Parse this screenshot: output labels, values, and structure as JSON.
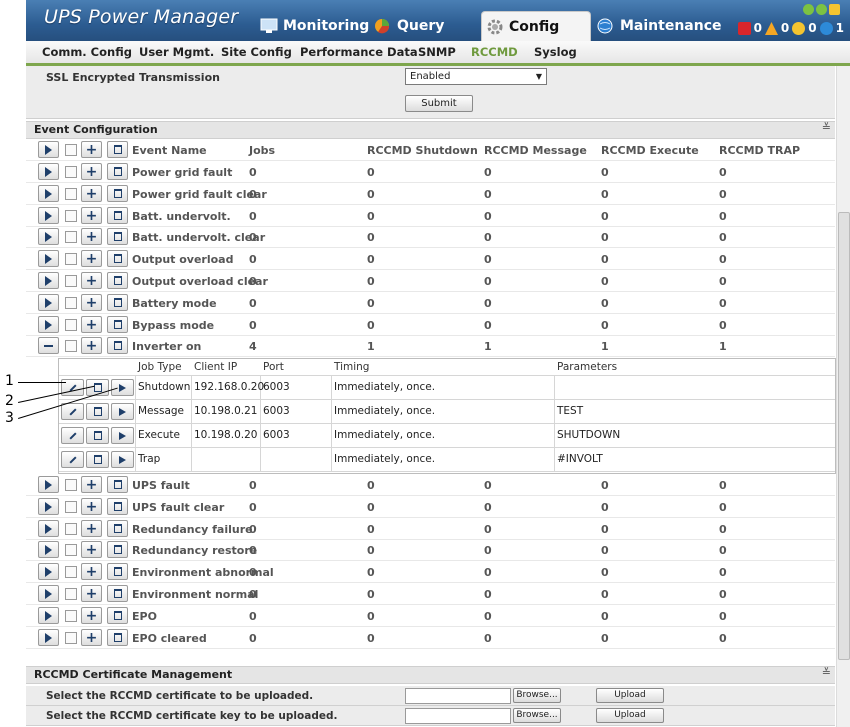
{
  "app": {
    "title": "UPS Power Manager"
  },
  "main_tabs": [
    {
      "label": "Monitoring",
      "icon": "monitor-icon"
    },
    {
      "label": "Query",
      "icon": "pie-chart-icon"
    },
    {
      "label": "Config",
      "icon": "gear-icon",
      "active": true
    },
    {
      "label": "Maintenance",
      "icon": "globe-icon"
    }
  ],
  "status": {
    "critical_count": "0",
    "warning_count": "0",
    "info_count": "0",
    "notice_count": "1"
  },
  "sub_tabs": [
    {
      "label": "Comm. Config"
    },
    {
      "label": "User Mgmt."
    },
    {
      "label": "Site Config"
    },
    {
      "label": "Performance Data"
    },
    {
      "label": "SNMP"
    },
    {
      "label": "RCCMD",
      "active": true
    },
    {
      "label": "Syslog"
    }
  ],
  "ssl": {
    "label": "SSL Encrypted Transmission",
    "value": "Enabled",
    "submit": "Submit"
  },
  "event_config": {
    "title": "Event Configuration",
    "columns": [
      "Event Name",
      "Jobs",
      "RCCMD Shutdown",
      "RCCMD Message",
      "RCCMD Execute",
      "RCCMD TRAP"
    ],
    "events_top": [
      {
        "name": "Power grid fault",
        "jobs": "0",
        "shutdown": "0",
        "message": "0",
        "execute": "0",
        "trap": "0"
      },
      {
        "name": "Power grid fault clear",
        "jobs": "0",
        "shutdown": "0",
        "message": "0",
        "execute": "0",
        "trap": "0"
      },
      {
        "name": "Batt. undervolt.",
        "jobs": "0",
        "shutdown": "0",
        "message": "0",
        "execute": "0",
        "trap": "0"
      },
      {
        "name": "Batt. undervolt. clear",
        "jobs": "0",
        "shutdown": "0",
        "message": "0",
        "execute": "0",
        "trap": "0"
      },
      {
        "name": "Output overload",
        "jobs": "0",
        "shutdown": "0",
        "message": "0",
        "execute": "0",
        "trap": "0"
      },
      {
        "name": "Output overload clear",
        "jobs": "0",
        "shutdown": "0",
        "message": "0",
        "execute": "0",
        "trap": "0"
      },
      {
        "name": "Battery mode",
        "jobs": "0",
        "shutdown": "0",
        "message": "0",
        "execute": "0",
        "trap": "0"
      },
      {
        "name": "Bypass mode",
        "jobs": "0",
        "shutdown": "0",
        "message": "0",
        "execute": "0",
        "trap": "0"
      },
      {
        "name": "Inverter on",
        "jobs": "4",
        "shutdown": "1",
        "message": "1",
        "execute": "1",
        "trap": "1"
      }
    ],
    "job_columns": [
      "Job Type",
      "Client IP",
      "Port",
      "Timing",
      "Parameters"
    ],
    "jobs": [
      {
        "type": "Shutdown",
        "ip": "192.168.0.20",
        "port": "6003",
        "timing": "Immediately, once.",
        "params": ""
      },
      {
        "type": "Message",
        "ip": "10.198.0.21",
        "port": "6003",
        "timing": "Immediately, once.",
        "params": "TEST"
      },
      {
        "type": "Execute",
        "ip": "10.198.0.20",
        "port": "6003",
        "timing": "Immediately, once.",
        "params": "SHUTDOWN"
      },
      {
        "type": "Trap",
        "ip": "",
        "port": "",
        "timing": "Immediately, once.",
        "params": "#INVOLT"
      }
    ],
    "events_bottom": [
      {
        "name": "UPS fault",
        "jobs": "0",
        "shutdown": "0",
        "message": "0",
        "execute": "0",
        "trap": "0"
      },
      {
        "name": "UPS fault clear",
        "jobs": "0",
        "shutdown": "0",
        "message": "0",
        "execute": "0",
        "trap": "0"
      },
      {
        "name": "Redundancy failure",
        "jobs": "0",
        "shutdown": "0",
        "message": "0",
        "execute": "0",
        "trap": "0"
      },
      {
        "name": "Redundancy restore",
        "jobs": "0",
        "shutdown": "0",
        "message": "0",
        "execute": "0",
        "trap": "0"
      },
      {
        "name": "Environment abnormal",
        "jobs": "0",
        "shutdown": "0",
        "message": "0",
        "execute": "0",
        "trap": "0"
      },
      {
        "name": "Environment normal",
        "jobs": "0",
        "shutdown": "0",
        "message": "0",
        "execute": "0",
        "trap": "0"
      },
      {
        "name": "EPO",
        "jobs": "0",
        "shutdown": "0",
        "message": "0",
        "execute": "0",
        "trap": "0"
      },
      {
        "name": "EPO cleared",
        "jobs": "0",
        "shutdown": "0",
        "message": "0",
        "execute": "0",
        "trap": "0"
      }
    ]
  },
  "callouts": [
    "1",
    "2",
    "3"
  ],
  "cert": {
    "title": "RCCMD Certificate Management",
    "rows": [
      {
        "label": "Select the RCCMD certificate to be uploaded.",
        "browse": "Browse...",
        "upload": "Upload"
      },
      {
        "label": "Select the RCCMD certificate key to be uploaded.",
        "browse": "Browse...",
        "upload": "Upload"
      }
    ]
  },
  "colors": {
    "header": "#2c5c91",
    "accent": "#7ea64d",
    "icon": "#1f3f6a"
  }
}
